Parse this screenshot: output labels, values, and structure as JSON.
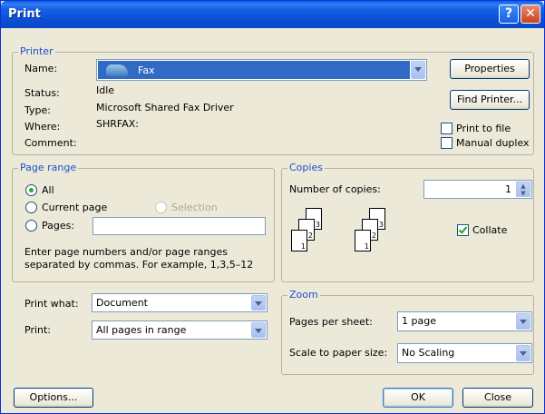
{
  "window": {
    "title": "Print"
  },
  "printer": {
    "legend": "Printer",
    "name_label": "Name:",
    "name_value": "Fax",
    "status_label": "Status:",
    "status_value": "Idle",
    "type_label": "Type:",
    "type_value": "Microsoft Shared Fax Driver",
    "where_label": "Where:",
    "where_value": "SHRFAX:",
    "comment_label": "Comment:",
    "properties_label": "Properties",
    "find_printer_label": "Find Printer...",
    "print_to_file_label": "Print to file",
    "manual_duplex_label": "Manual duplex"
  },
  "page_range": {
    "legend": "Page range",
    "all_label": "All",
    "current_label": "Current page",
    "selection_label": "Selection",
    "pages_label": "Pages:",
    "hint_line1": "Enter page numbers and/or page ranges",
    "hint_line2": "separated by commas.  For example, 1,3,5–12"
  },
  "copies": {
    "legend": "Copies",
    "number_label": "Number of copies:",
    "number_value": "1",
    "collate_label": "Collate"
  },
  "print_what": {
    "label": "Print what:",
    "value": "Document"
  },
  "print": {
    "label": "Print:",
    "value": "All pages in range"
  },
  "zoom": {
    "legend": "Zoom",
    "pages_per_sheet_label": "Pages per sheet:",
    "pages_per_sheet_value": "1 page",
    "scale_label": "Scale to paper size:",
    "scale_value": "No Scaling"
  },
  "footer": {
    "options_label": "Options...",
    "ok_label": "OK",
    "close_label": "Close"
  }
}
